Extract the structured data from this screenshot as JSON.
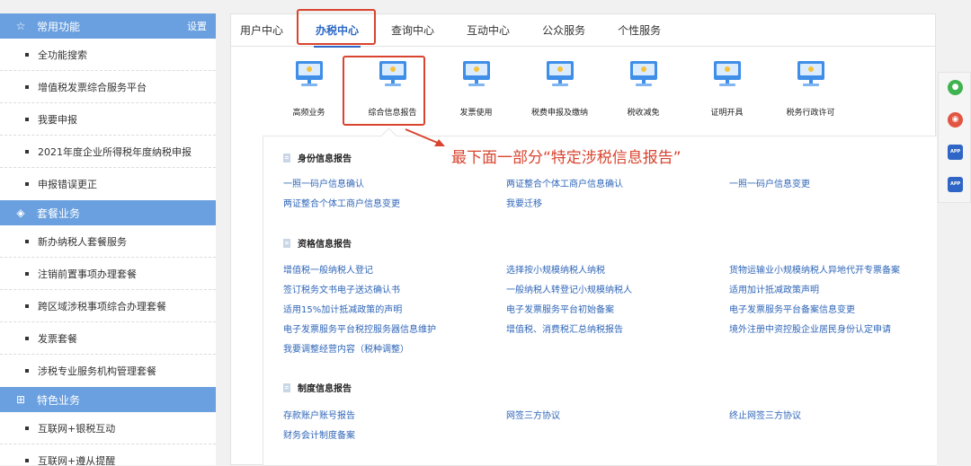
{
  "sidebar": {
    "section1": {
      "title": "常用功能",
      "right": "设置",
      "icon": "star-icon",
      "items": [
        "全功能搜索",
        "增值税发票综合服务平台",
        "我要申报",
        "2021年度企业所得税年度纳税申报",
        "申报错误更正"
      ]
    },
    "section2": {
      "title": "套餐业务",
      "icon": "layers-icon",
      "items": [
        "新办纳税人套餐服务",
        "注销前置事项办理套餐",
        "跨区域涉税事项综合办理套餐",
        "发票套餐",
        "涉税专业服务机构管理套餐"
      ]
    },
    "section3": {
      "title": "特色业务",
      "icon": "grid-icon",
      "items": [
        "互联网+银税互动",
        "互联网+遵从提醒"
      ]
    }
  },
  "tabs": [
    "用户中心",
    "办税中心",
    "查询中心",
    "互动中心",
    "公众服务",
    "个性服务"
  ],
  "active_tab": "办税中心",
  "functions": [
    "高频业务",
    "综合信息报告",
    "发票使用",
    "税费申报及缴纳",
    "税收减免",
    "证明开具",
    "税务行政许可"
  ],
  "groups": {
    "g1": {
      "title": "身份信息报告",
      "links": [
        "一照一码户信息确认",
        "两证整合个体工商户信息确认",
        "一照一码户信息变更",
        "两证整合个体工商户信息变更",
        "我要迁移"
      ]
    },
    "g2": {
      "title": "资格信息报告",
      "links": [
        "增值税一般纳税人登记",
        "选择按小规模纳税人纳税",
        "货物运输业小规模纳税人异地代开专票备案",
        "签订税务文书电子送达确认书",
        "一般纳税人转登记小规模纳税人",
        "适用加计抵减政策声明",
        "适用15%加计抵减政策的声明",
        "电子发票服务平台初始备案",
        "电子发票服务平台备案信息变更",
        "电子发票服务平台税控服务器信息维护",
        "增值税、消费税汇总纳税报告",
        "境外注册中资控股企业居民身份认定申请",
        "我要调整经营内容（税种调整）"
      ]
    },
    "g3": {
      "title": "制度信息报告",
      "links": [
        "存款账户账号报告",
        "网签三方协议",
        "终止网签三方协议",
        "财务会计制度备案"
      ]
    }
  },
  "annotation": "最下面一部分“特定涉税信息报告”",
  "floatbar": [
    "wechat-icon",
    "weibo-icon",
    "app-icon",
    "app-icon"
  ],
  "colors": {
    "sidebar_header": "#6aa0df",
    "active_tab": "#2a67c6",
    "link": "#2f66b8",
    "annotation": "#d9442f"
  }
}
